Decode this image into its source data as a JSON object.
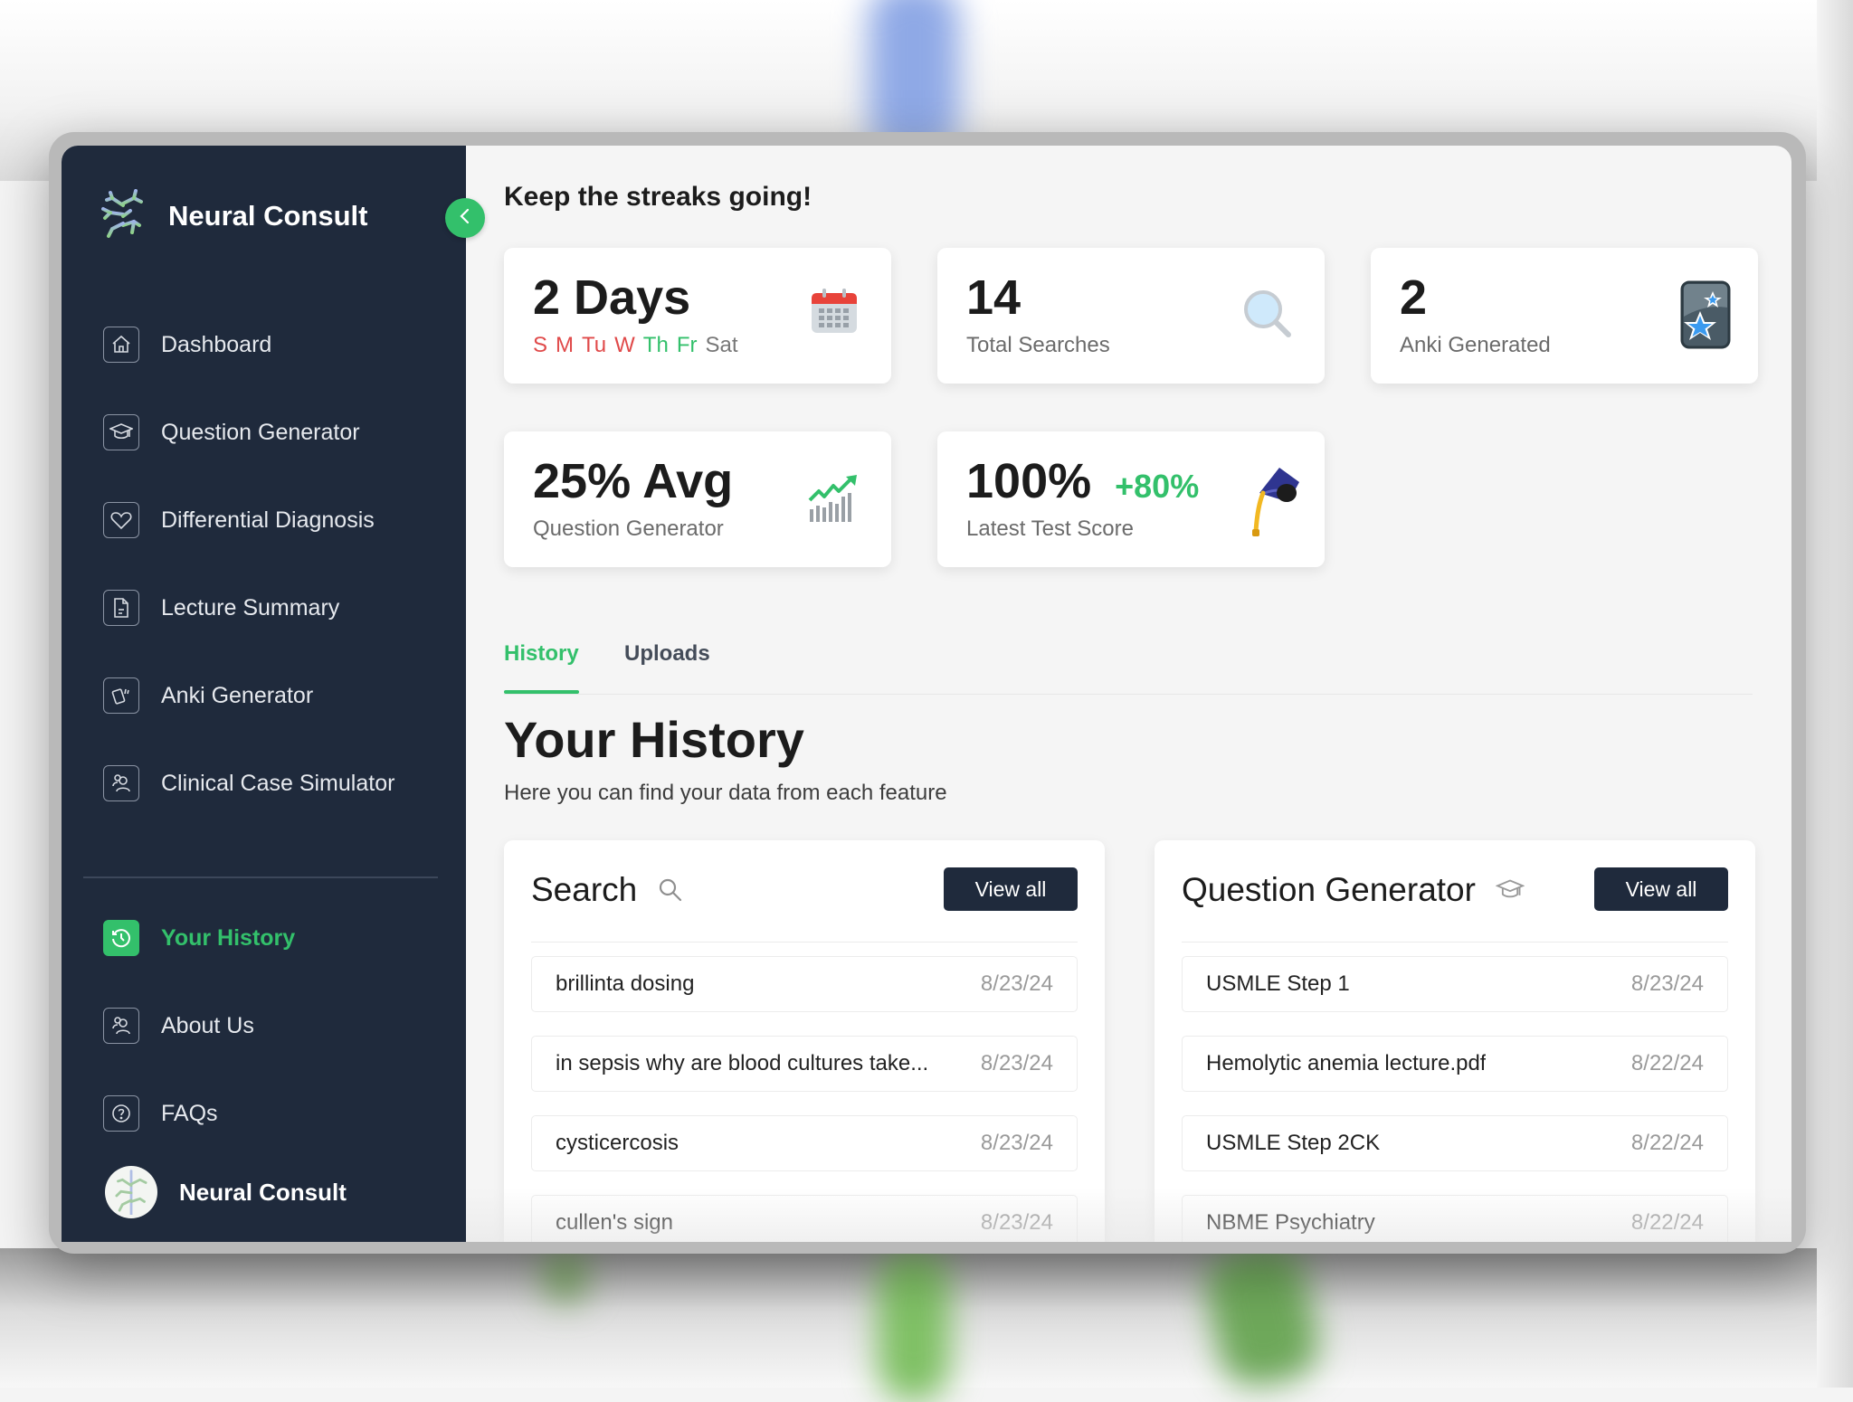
{
  "app": {
    "brand_name": "Neural Consult",
    "accent_color": "#33c06b",
    "sidebar_color": "#1f2a3c"
  },
  "sidebar": {
    "items": [
      {
        "label": "Dashboard",
        "icon": "home-icon"
      },
      {
        "label": "Question Generator",
        "icon": "graduation-cap-icon"
      },
      {
        "label": "Differential Diagnosis",
        "icon": "heart-icon"
      },
      {
        "label": "Lecture Summary",
        "icon": "document-icon"
      },
      {
        "label": "Anki Generator",
        "icon": "cards-icon"
      },
      {
        "label": "Clinical Case Simulator",
        "icon": "users-icon"
      }
    ],
    "secondary_items": [
      {
        "label": "Your History",
        "icon": "history-icon",
        "active": true
      },
      {
        "label": "About Us",
        "icon": "users-icon"
      },
      {
        "label": "FAQs",
        "icon": "question-circle-icon"
      }
    ],
    "profile_name": "Neural Consult"
  },
  "streaks": {
    "heading": "Keep the streaks going!",
    "cards": [
      {
        "value": "2 Days",
        "icon": "calendar-icon",
        "days": [
          {
            "label": "S",
            "status": "missed",
            "color": "#e04a4a"
          },
          {
            "label": "M",
            "status": "missed",
            "color": "#e04a4a"
          },
          {
            "label": "Tu",
            "status": "missed",
            "color": "#e04a4a"
          },
          {
            "label": "W",
            "status": "missed",
            "color": "#e04a4a"
          },
          {
            "label": "Th",
            "status": "done",
            "color": "#33c06b"
          },
          {
            "label": "Fr",
            "status": "done",
            "color": "#33c06b"
          },
          {
            "label": "Sat",
            "status": "upcoming",
            "color": "#777777"
          }
        ]
      },
      {
        "value": "14",
        "label": "Total Searches",
        "icon": "magnifier-icon"
      },
      {
        "value": "2",
        "label": "Anki Generated",
        "icon": "anki-icon"
      },
      {
        "value": "25% Avg",
        "label": "Question Generator",
        "icon": "growth-chart-icon"
      },
      {
        "value": "100%",
        "delta": "+80%",
        "label": "Latest Test Score",
        "icon": "graduation-cap-icon"
      }
    ]
  },
  "tabs": [
    {
      "label": "History",
      "active": true
    },
    {
      "label": "Uploads",
      "active": false
    }
  ],
  "history": {
    "title": "Your History",
    "subtitle": "Here you can find your data from each feature",
    "panels": [
      {
        "title": "Search",
        "icon": "search-icon",
        "button": "View all",
        "rows": [
          {
            "text": "brillinta dosing",
            "date": "8/23/24"
          },
          {
            "text": "in sepsis why are blood cultures take...",
            "date": "8/23/24"
          },
          {
            "text": "cysticercosis",
            "date": "8/23/24"
          },
          {
            "text": "cullen's sign",
            "date": "8/23/24"
          }
        ]
      },
      {
        "title": "Question Generator",
        "icon": "graduation-cap-icon",
        "button": "View all",
        "rows": [
          {
            "text": "USMLE Step 1",
            "date": "8/23/24"
          },
          {
            "text": "Hemolytic anemia lecture.pdf",
            "date": "8/22/24"
          },
          {
            "text": "USMLE Step 2CK",
            "date": "8/22/24"
          },
          {
            "text": "NBME Psychiatry",
            "date": "8/22/24"
          }
        ]
      }
    ]
  }
}
